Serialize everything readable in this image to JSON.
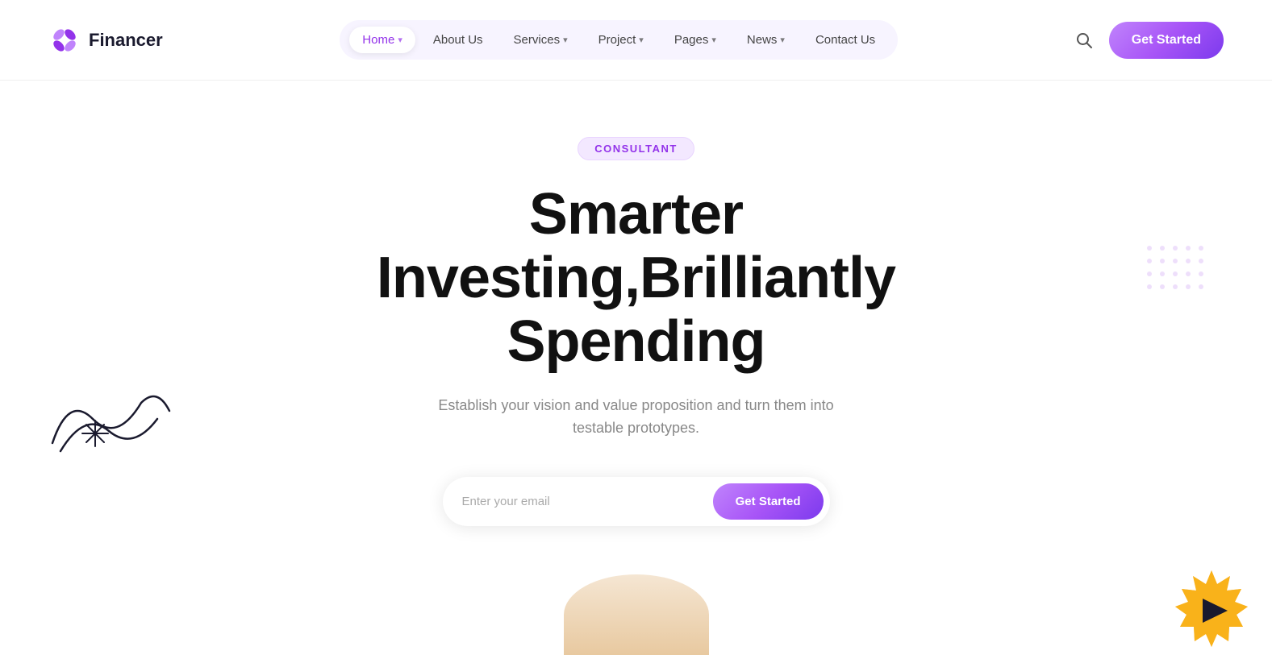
{
  "logo": {
    "text": "Financer"
  },
  "nav": {
    "items": [
      {
        "label": "Home",
        "hasDropdown": true,
        "active": true
      },
      {
        "label": "About Us",
        "hasDropdown": false,
        "active": false
      },
      {
        "label": "Services",
        "hasDropdown": true,
        "active": false
      },
      {
        "label": "Project",
        "hasDropdown": true,
        "active": false
      },
      {
        "label": "Pages",
        "hasDropdown": true,
        "active": false
      },
      {
        "label": "News",
        "hasDropdown": true,
        "active": false
      },
      {
        "label": "Contact Us",
        "hasDropdown": false,
        "active": false
      }
    ],
    "get_started_label": "Get Started"
  },
  "hero": {
    "badge": "CONSULTANT",
    "title_line1": "Smarter Investing,Brilliantly",
    "title_line2": "Spending",
    "subtitle": "Establish your vision and value proposition and turn them into testable prototypes.",
    "email_placeholder": "Enter your email",
    "cta_label": "Get Started"
  },
  "colors": {
    "accent": "#a855f7",
    "accent_gradient_start": "#c084fc",
    "accent_gradient_end": "#7c3aed"
  }
}
